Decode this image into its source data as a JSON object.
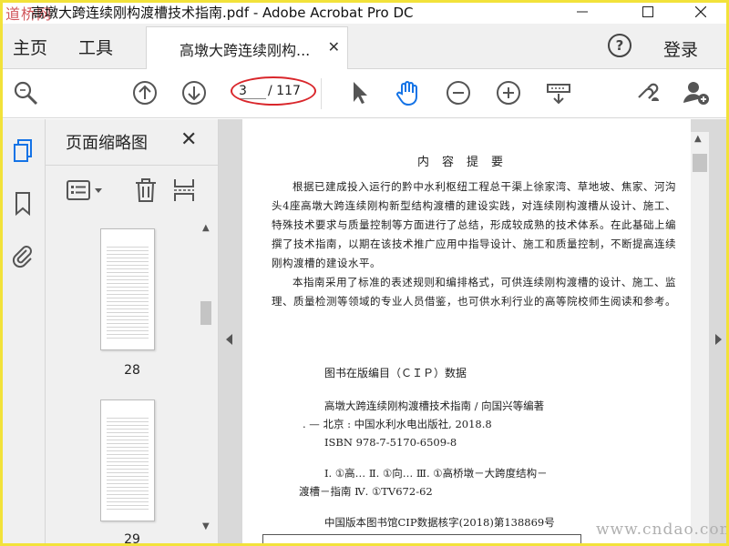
{
  "window": {
    "logo_text": "道桥网",
    "title": "高墩大跨连续刚构渡槽技术指南.pdf - Adobe Acrobat Pro DC"
  },
  "tabs": {
    "home": "主页",
    "tools": "工具",
    "document": "高墩大跨连续刚构...",
    "login": "登录"
  },
  "toolbar": {
    "current_page": "3",
    "page_total": "/ 117"
  },
  "thumbnails_panel": {
    "title": "页面缩略图",
    "pages": [
      {
        "label": "28"
      },
      {
        "label": "29"
      }
    ]
  },
  "document": {
    "heading": "内容提要",
    "paragraphs": [
      "根据已建成投入运行的黔中水利枢纽工程总干渠上徐家湾、草地坡、焦家、河沟头4座高墩大跨连续刚构新型结构渡槽的建设实践，对连续刚构渡槽从设计、施工、特殊技术要求与质量控制等方面进行了总结，形成较成熟的技术体系。在此基础上编撰了技术指南，以期在该技术推广应用中指导设计、施工和质量控制，不断提高连续刚构渡槽的建设水平。",
      "本指南采用了标准的表述规则和编排格式，可供连续刚构渡槽的设计、施工、监理、质量检测等领域的专业人员借鉴，也可供水利行业的高等院校师生阅读和参考。"
    ],
    "cip_title": "图书在版编目（ＣＩＰ）数据",
    "cip_line1": "高墩大跨连续刚构渡槽技术指南 / 向国兴等编著",
    "cip_line2": ". — 北京 : 中国水利水电出版社, 2018.8",
    "cip_line3": "ISBN 978-7-5170-6509-8",
    "cip_line4": "Ⅰ. ①高… Ⅱ. ①向… Ⅲ. ①高桥墩－大跨度结构－",
    "cip_line5": "渡槽－指南 Ⅳ. ①TV672-62",
    "cip_line6": "中国版本图书馆CIP数据核字(2018)第138869号"
  },
  "watermark": "www.cndao.com",
  "colors": {
    "accent": "#1473e6",
    "frame": "#f2e23a",
    "annotation": "#d9262b"
  }
}
